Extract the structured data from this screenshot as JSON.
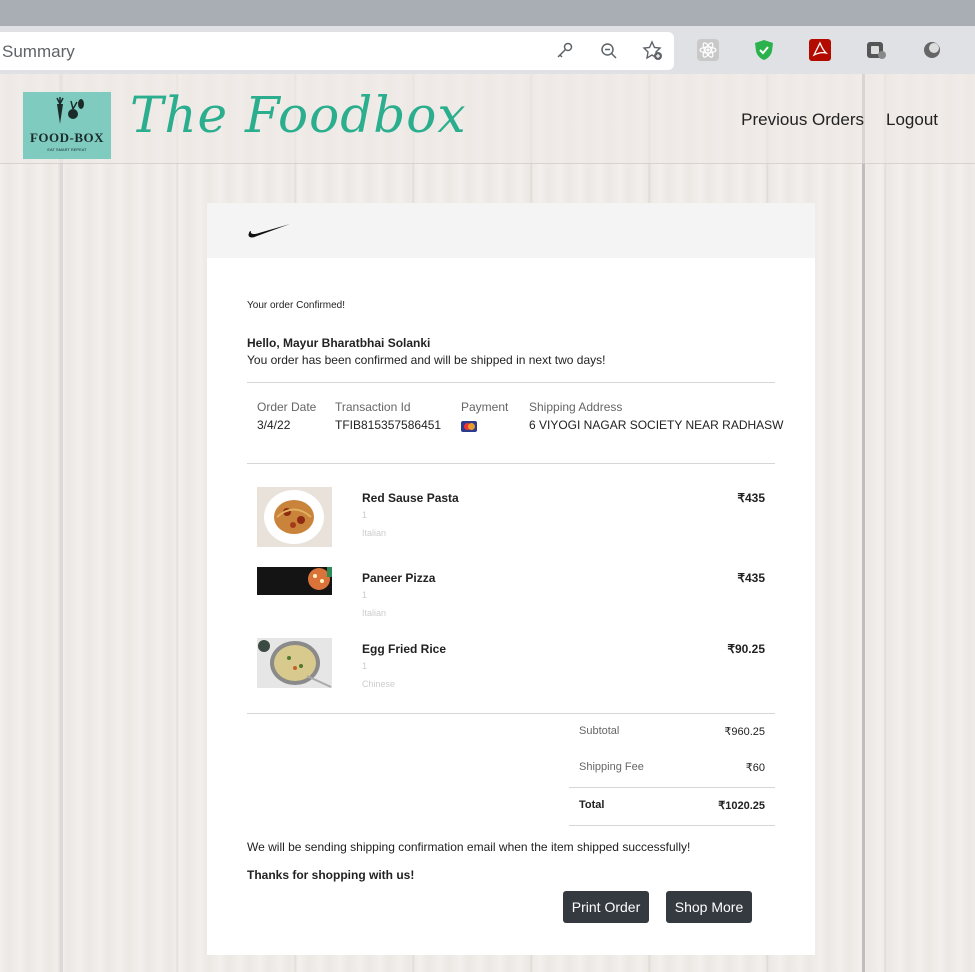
{
  "browser": {
    "url_text": "Summary",
    "icons": [
      "key-icon",
      "zoom-out-icon",
      "add-bookmark-icon"
    ],
    "extensions": [
      "react-devtools-icon",
      "shield-check-icon",
      "acrobat-icon",
      "tab-extension-icon",
      "circle-extension-icon"
    ]
  },
  "site": {
    "logo_text": "FOOD-BOX",
    "logo_subtext": "EAT SMART REPEAT",
    "brand_name": "The Foodbox",
    "nav": {
      "previous_orders": "Previous Orders",
      "logout": "Logout"
    }
  },
  "order": {
    "small_title": "Your order Confirmed!",
    "greeting": "Hello, Mayur Bharatbhai Solanki",
    "confirm_message": "You order has been confirmed and will be shipped in next two days!",
    "meta": {
      "order_date_label": "Order Date",
      "order_date": "3/4/22",
      "transaction_label": "Transaction Id",
      "transaction_id": "TFIB815357586451",
      "payment_label": "Payment",
      "payment_icon": "mastercard-icon",
      "address_label": "Shipping Address",
      "address": "6 VIYOGI NAGAR SOCIETY NEAR RADHASW"
    },
    "items": [
      {
        "name": "Red Sause Pasta",
        "qty": "1",
        "category": "Italian",
        "price": "₹435"
      },
      {
        "name": "Paneer Pizza",
        "qty": "1",
        "category": "Italian",
        "price": "₹435"
      },
      {
        "name": "Egg Fried Rice",
        "qty": "1",
        "category": "Chinese",
        "price": "₹90.25"
      }
    ],
    "totals": {
      "subtotal_label": "Subtotal",
      "subtotal": "₹960.25",
      "shipping_label": "Shipping Fee",
      "shipping": "₹60",
      "total_label": "Total",
      "total": "₹1020.25"
    },
    "shipping_note": "We will be sending shipping confirmation email when the item shipped successfully!",
    "thanks": "Thanks for shopping with us!",
    "buttons": {
      "print": "Print Order",
      "shop_more": "Shop More"
    }
  },
  "colors": {
    "brand": "#2aae8e",
    "logo_bg": "#7fcbc0",
    "button": "#343a40"
  }
}
